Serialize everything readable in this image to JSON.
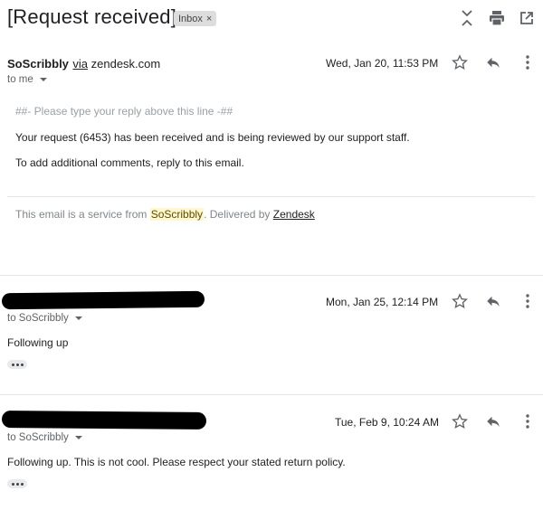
{
  "header": {
    "subject": "[Request received]",
    "label": "Inbox",
    "label_close": "×",
    "icons": [
      "expand-collapse-icon",
      "print-icon",
      "open-in-new-window-icon"
    ]
  },
  "messages": [
    {
      "sender": "SoScribbly",
      "via_word": "via",
      "via_domain": "zendesk.com",
      "date": "Wed, Jan 20, 11:53 PM",
      "to": "to me",
      "body": {
        "reply_marker": "##- Please type your reply above this line -##",
        "line1": "Your request (6453) has been received and is being reviewed by our support staff.",
        "line2": "To add additional comments, reply to this email."
      },
      "footer": {
        "prefix": "This email is a service from ",
        "brand": "SoScribbly",
        "middle": ". Delivered by ",
        "link": "Zendesk"
      }
    },
    {
      "sender_redacted": true,
      "date": "Mon, Jan 25, 12:14 PM",
      "to": "to SoScribbly",
      "body": "Following up"
    },
    {
      "sender_redacted": true,
      "date": "Tue, Feb 9, 10:24 AM",
      "to": "to SoScribbly",
      "body": "Following up. This is not cool. Please respect your stated return policy."
    }
  ],
  "colors": {
    "text": "#202124",
    "muted": "#5f6368",
    "label_bg": "#dddddd",
    "highlight": "#fdf8cf"
  }
}
